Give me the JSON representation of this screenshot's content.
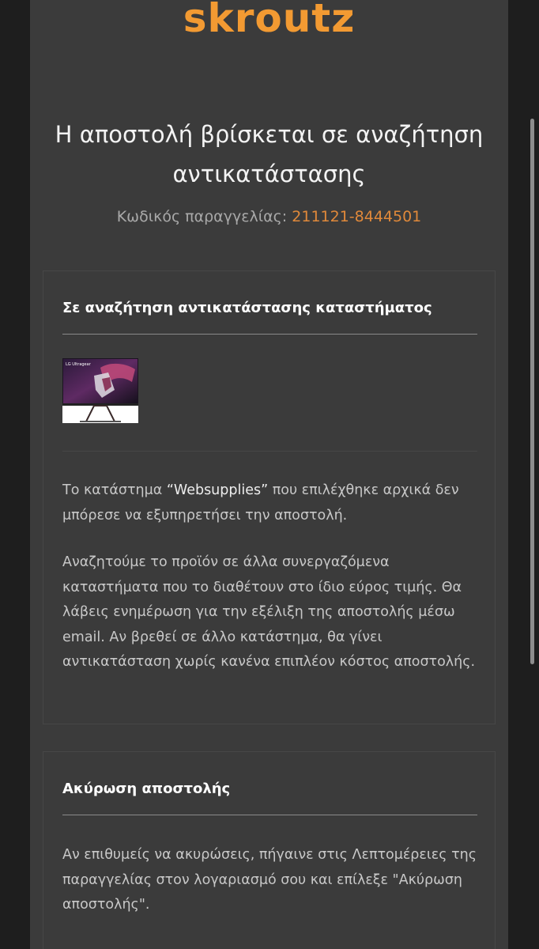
{
  "brand": {
    "logo_text": "skroutz",
    "color": "#f29a32"
  },
  "header": {
    "title_line1": "Η αποστολή βρίσκεται σε αναζήτηση",
    "title_line2": "αντικατάστασης",
    "order_label": "Κωδικός παραγγελίας:",
    "order_code": "211121-8444501"
  },
  "status_card": {
    "title": "Σε αναζήτηση αντικατάστασης καταστήματος",
    "product_image": {
      "label": "LG Ultragear",
      "icon": "monitor-product-image"
    },
    "paragraph1_pre": "Το κατάστημα ",
    "store_name": "“Websupplies”",
    "paragraph1_post": " που επιλέχθηκε αρχικά δεν μπόρεσε να εξυπηρετήσει την αποστολή.",
    "paragraph2": "Αναζητούμε το προϊόν σε άλλα συνεργαζόμενα καταστήματα που το διαθέτουν στο ίδιο εύρος τιμής. Θα λάβεις ενημέρωση για την εξέλιξη της αποστολής μέσω email. Αν βρεθεί σε άλλο κατάστημα, θα γίνει αντικατάσταση χωρίς κανένα επιπλέον κόστος αποστολής."
  },
  "cancel_card": {
    "title": "Ακύρωση αποστολής",
    "paragraph": "Αν επιθυμείς να ακυρώσεις, πήγαινε στις Λεπτομέρειες της παραγγελίας στον λογαριασμό σου και επίλεξε \"Ακύρωση αποστολής\"."
  },
  "colors": {
    "background": "#1e1e1e",
    "email_body": "#3b3b3b",
    "accent_orange": "#e0893a"
  }
}
